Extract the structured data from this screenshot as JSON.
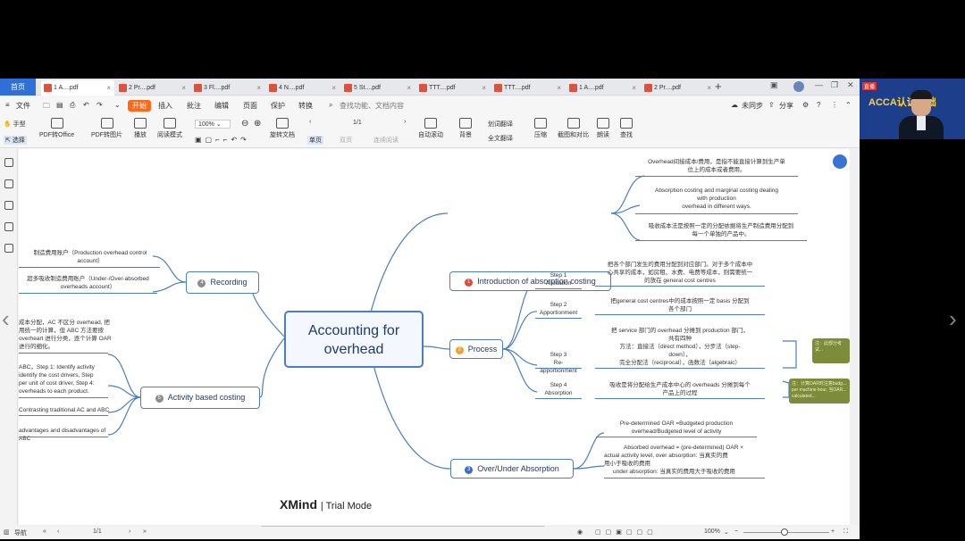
{
  "tabbar": {
    "home": "首页",
    "tabs": [
      "1 A....pdf",
      "2 Pr....pdf",
      "3 Fl....pdf",
      "4 N....pdf",
      "5 St....pdf",
      "TTT....pdf",
      "TTT....pdf",
      "1 A....pdf",
      "2 Pr....pdf"
    ],
    "close_glyph": "×",
    "plus_glyph": "+"
  },
  "menubar": {
    "file": "文件",
    "start": "开始",
    "items": [
      "插入",
      "批注",
      "编辑",
      "页面",
      "保护",
      "转换"
    ],
    "search_placeholder": "查找功能、文档内容",
    "sync": "未同步",
    "share": "分享"
  },
  "toolbar": {
    "hand": "手型",
    "select": "选择",
    "to_office": "PDF转Office",
    "to_image": "PDF转图片",
    "play": "播放",
    "read_mode": "阅读模式",
    "zoom": "100%",
    "rotate": "旋转文档",
    "page_indicator": "1/1",
    "single_page": "单页",
    "double_page": "双页",
    "continuous": "连续阅读",
    "auto_scroll": "自动滚动",
    "background": "背景",
    "translate": "划词翻译",
    "full_translate": "全文翻译",
    "compress": "压缩",
    "screenshot_compare": "截图和对比",
    "read_aloud": "朗读",
    "find": "查找"
  },
  "mindmap": {
    "central": [
      "Accounting for",
      "overhead"
    ],
    "intro": {
      "num": "1",
      "label": "Introduction of absorption costing",
      "leaves": [
        [
          "Overhead间接成本/费用，是指不能直接计算到生产单",
          "位上的成本或者费用。"
        ],
        [
          "Absorption costing and marginal costing dealing",
          "with production",
          "overhead in different ways."
        ],
        [
          "吸收成本法是按照一定的分配依据将生产制造费用分配到",
          "每一个单独的产品中。"
        ]
      ]
    },
    "process": {
      "num": "2",
      "label": "Process",
      "steps": [
        {
          "title": [
            "Step 1",
            "Allocation"
          ],
          "desc": [
            "把各个部门发生的费用分配到对应部门。对于多个成本中",
            "心共享的成本，如房租、水费、电费等成本，则需要统一",
            "的放在 general cost centres"
          ]
        },
        {
          "title": [
            "Step 2",
            "Apportionment"
          ],
          "desc": [
            "把general cost centres中的成本按照一定 basis 分配到",
            "各个部门"
          ]
        },
        {
          "title": [
            "Step 3",
            "Re-apportionment"
          ],
          "desc": [
            "把 service 部门的 overhead 分摊到 production 部门，",
            "共有四种",
            "方法：直接法（direct method），分步法（step-",
            "down），",
            "完全分配法（reciprocal），函数法（algebraic）"
          ]
        },
        {
          "title": [
            "Step 4",
            "Absorption"
          ],
          "desc": [
            "吸收是将分配给生产成本中心的 overheads 分摊到每个",
            "产品上的过程"
          ]
        }
      ],
      "note1": "注：此部分考试...",
      "note2": [
        "注：计算OAR时注意budg...",
        "per machine hour, 当OAR...",
        "calculated..."
      ]
    },
    "overunder": {
      "num": "3",
      "label": "Over/Under Absorption",
      "leaves": [
        [
          "Pre-determined OAR =Budgeted production",
          "overhead/Budgeted level of activity"
        ],
        [
          "Absorbed overhead = (pre-determined) OAR ×",
          "actual activity level,       over absorption: 当真实的费",
          "用小于吸收的费用",
          "under absorption: 当真实的费用大于吸收的费用"
        ]
      ]
    },
    "recording": {
      "num": "4",
      "label": "Recording",
      "leaves": [
        [
          "制造费用账户（Production overhead control",
          "account）"
        ],
        [
          "超多吸收制造费用账户（Under-/Over-absorbed",
          "overheads account）"
        ]
      ]
    },
    "abc": {
      "num": "5",
      "label": "Activity based costing",
      "leaves": [
        [
          "成本分配，AC 不区分 overhead, 把",
          "用统一的计算，但 ABC 方法要按",
          "overheart 进行分类，逐个计算 OAR",
          "进行的细化。"
        ],
        [
          "ABC，Step 1: Identify activity",
          "identify the cost drivers, Step",
          "per unit of cost driver, Step 4:",
          "overheads to each product."
        ],
        [
          "Contrasting traditional AC and ABC"
        ],
        [
          "advantages and disadvantages of ABC"
        ]
      ]
    },
    "watermark_brand": "XMind",
    "watermark_mode": "| Trial Mode"
  },
  "statusbar": {
    "nav": "导航",
    "page": "1/1",
    "zoom": "100%"
  },
  "video": {
    "banner": "ACCA认证基础",
    "tag": "直播"
  },
  "colors": {
    "accent": "#2f6fd8",
    "start_button": "#ff6a1a",
    "node_border": "#4a7fc1",
    "intro_dot": "#e3483a",
    "process_dot": "#f0a030",
    "overunder_dot": "#3a6ec6",
    "recording_dot": "#8c8c8c",
    "abc_dot": "#8c8c8c",
    "note": "#7d8c3a"
  }
}
